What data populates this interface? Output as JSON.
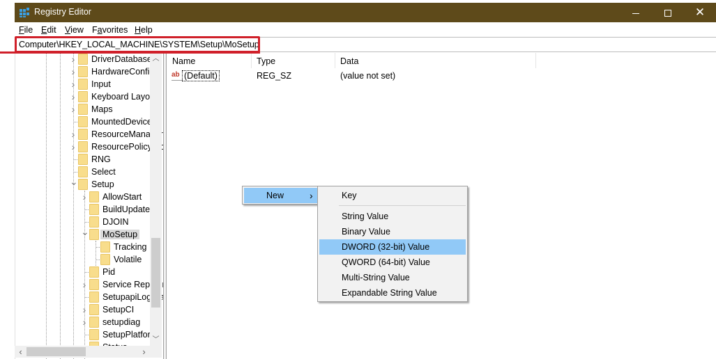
{
  "window": {
    "title": "Registry Editor",
    "titlebar_color": "#5e4a1a",
    "controls": {
      "minimize": "minimize-icon",
      "maximize": "maximize-icon",
      "close": "close-icon"
    }
  },
  "menubar": {
    "items": [
      {
        "label": "File",
        "accel": "F",
        "rest": "ile"
      },
      {
        "label": "Edit",
        "accel": "E",
        "rest": "dit"
      },
      {
        "label": "View",
        "accel": "V",
        "rest": "iew"
      },
      {
        "label": "Favorites",
        "accel": "a",
        "pre": "F",
        "rest": "vorites"
      },
      {
        "label": "Help",
        "accel": "H",
        "rest": "elp"
      }
    ]
  },
  "address": {
    "path": "Computer\\HKEY_LOCAL_MACHINE\\SYSTEM\\Setup\\MoSetup",
    "highlight_color": "#d0202a"
  },
  "tree": {
    "items": [
      {
        "label": "DriverDatabase",
        "level": 0,
        "expander": "collapsed"
      },
      {
        "label": "HardwareConfig",
        "level": 0,
        "expander": "collapsed"
      },
      {
        "label": "Input",
        "level": 0,
        "expander": "collapsed"
      },
      {
        "label": "Keyboard Layout",
        "level": 0,
        "expander": "collapsed"
      },
      {
        "label": "Maps",
        "level": 0,
        "expander": "collapsed"
      },
      {
        "label": "MountedDevices",
        "level": 0,
        "expander": "none"
      },
      {
        "label": "ResourceManager",
        "level": 0,
        "expander": "collapsed"
      },
      {
        "label": "ResourcePolicyStore",
        "level": 0,
        "expander": "collapsed"
      },
      {
        "label": "RNG",
        "level": 0,
        "expander": "none"
      },
      {
        "label": "Select",
        "level": 0,
        "expander": "none"
      },
      {
        "label": "Setup",
        "level": 0,
        "expander": "expanded"
      },
      {
        "label": "AllowStart",
        "level": 1,
        "expander": "collapsed"
      },
      {
        "label": "BuildUpdate",
        "level": 1,
        "expander": "none"
      },
      {
        "label": "DJOIN",
        "level": 1,
        "expander": "none"
      },
      {
        "label": "MoSetup",
        "level": 1,
        "expander": "expanded",
        "selected": true
      },
      {
        "label": "Tracking",
        "level": 2,
        "expander": "none"
      },
      {
        "label": "Volatile",
        "level": 2,
        "expander": "none"
      },
      {
        "label": "Pid",
        "level": 1,
        "expander": "none"
      },
      {
        "label": "Service Reporting",
        "level": 1,
        "expander": "collapsed"
      },
      {
        "label": "SetupapiLogStatus",
        "level": 1,
        "expander": "none"
      },
      {
        "label": "SetupCI",
        "level": 1,
        "expander": "collapsed"
      },
      {
        "label": "setupdiag",
        "level": 1,
        "expander": "collapsed"
      },
      {
        "label": "SetupPlatform",
        "level": 1,
        "expander": "none"
      },
      {
        "label": "Status",
        "level": 1,
        "expander": "collapsed"
      }
    ]
  },
  "values_pane": {
    "columns": [
      "Name",
      "Type",
      "Data"
    ],
    "rows": [
      {
        "icon": "string-value-icon",
        "name": "(Default)",
        "type": "REG_SZ",
        "data": "(value not set)"
      }
    ]
  },
  "context_menu": {
    "parent_item": {
      "label": "New",
      "arrow": "›"
    },
    "submenu": {
      "items": [
        {
          "label": "Key"
        },
        {
          "separator": true
        },
        {
          "label": "String Value"
        },
        {
          "label": "Binary Value"
        },
        {
          "label": "DWORD (32-bit) Value",
          "highlighted": true
        },
        {
          "label": "QWORD (64-bit) Value"
        },
        {
          "label": "Multi-String Value"
        },
        {
          "label": "Expandable String Value"
        }
      ]
    },
    "highlight_color": "#91c9f7"
  }
}
